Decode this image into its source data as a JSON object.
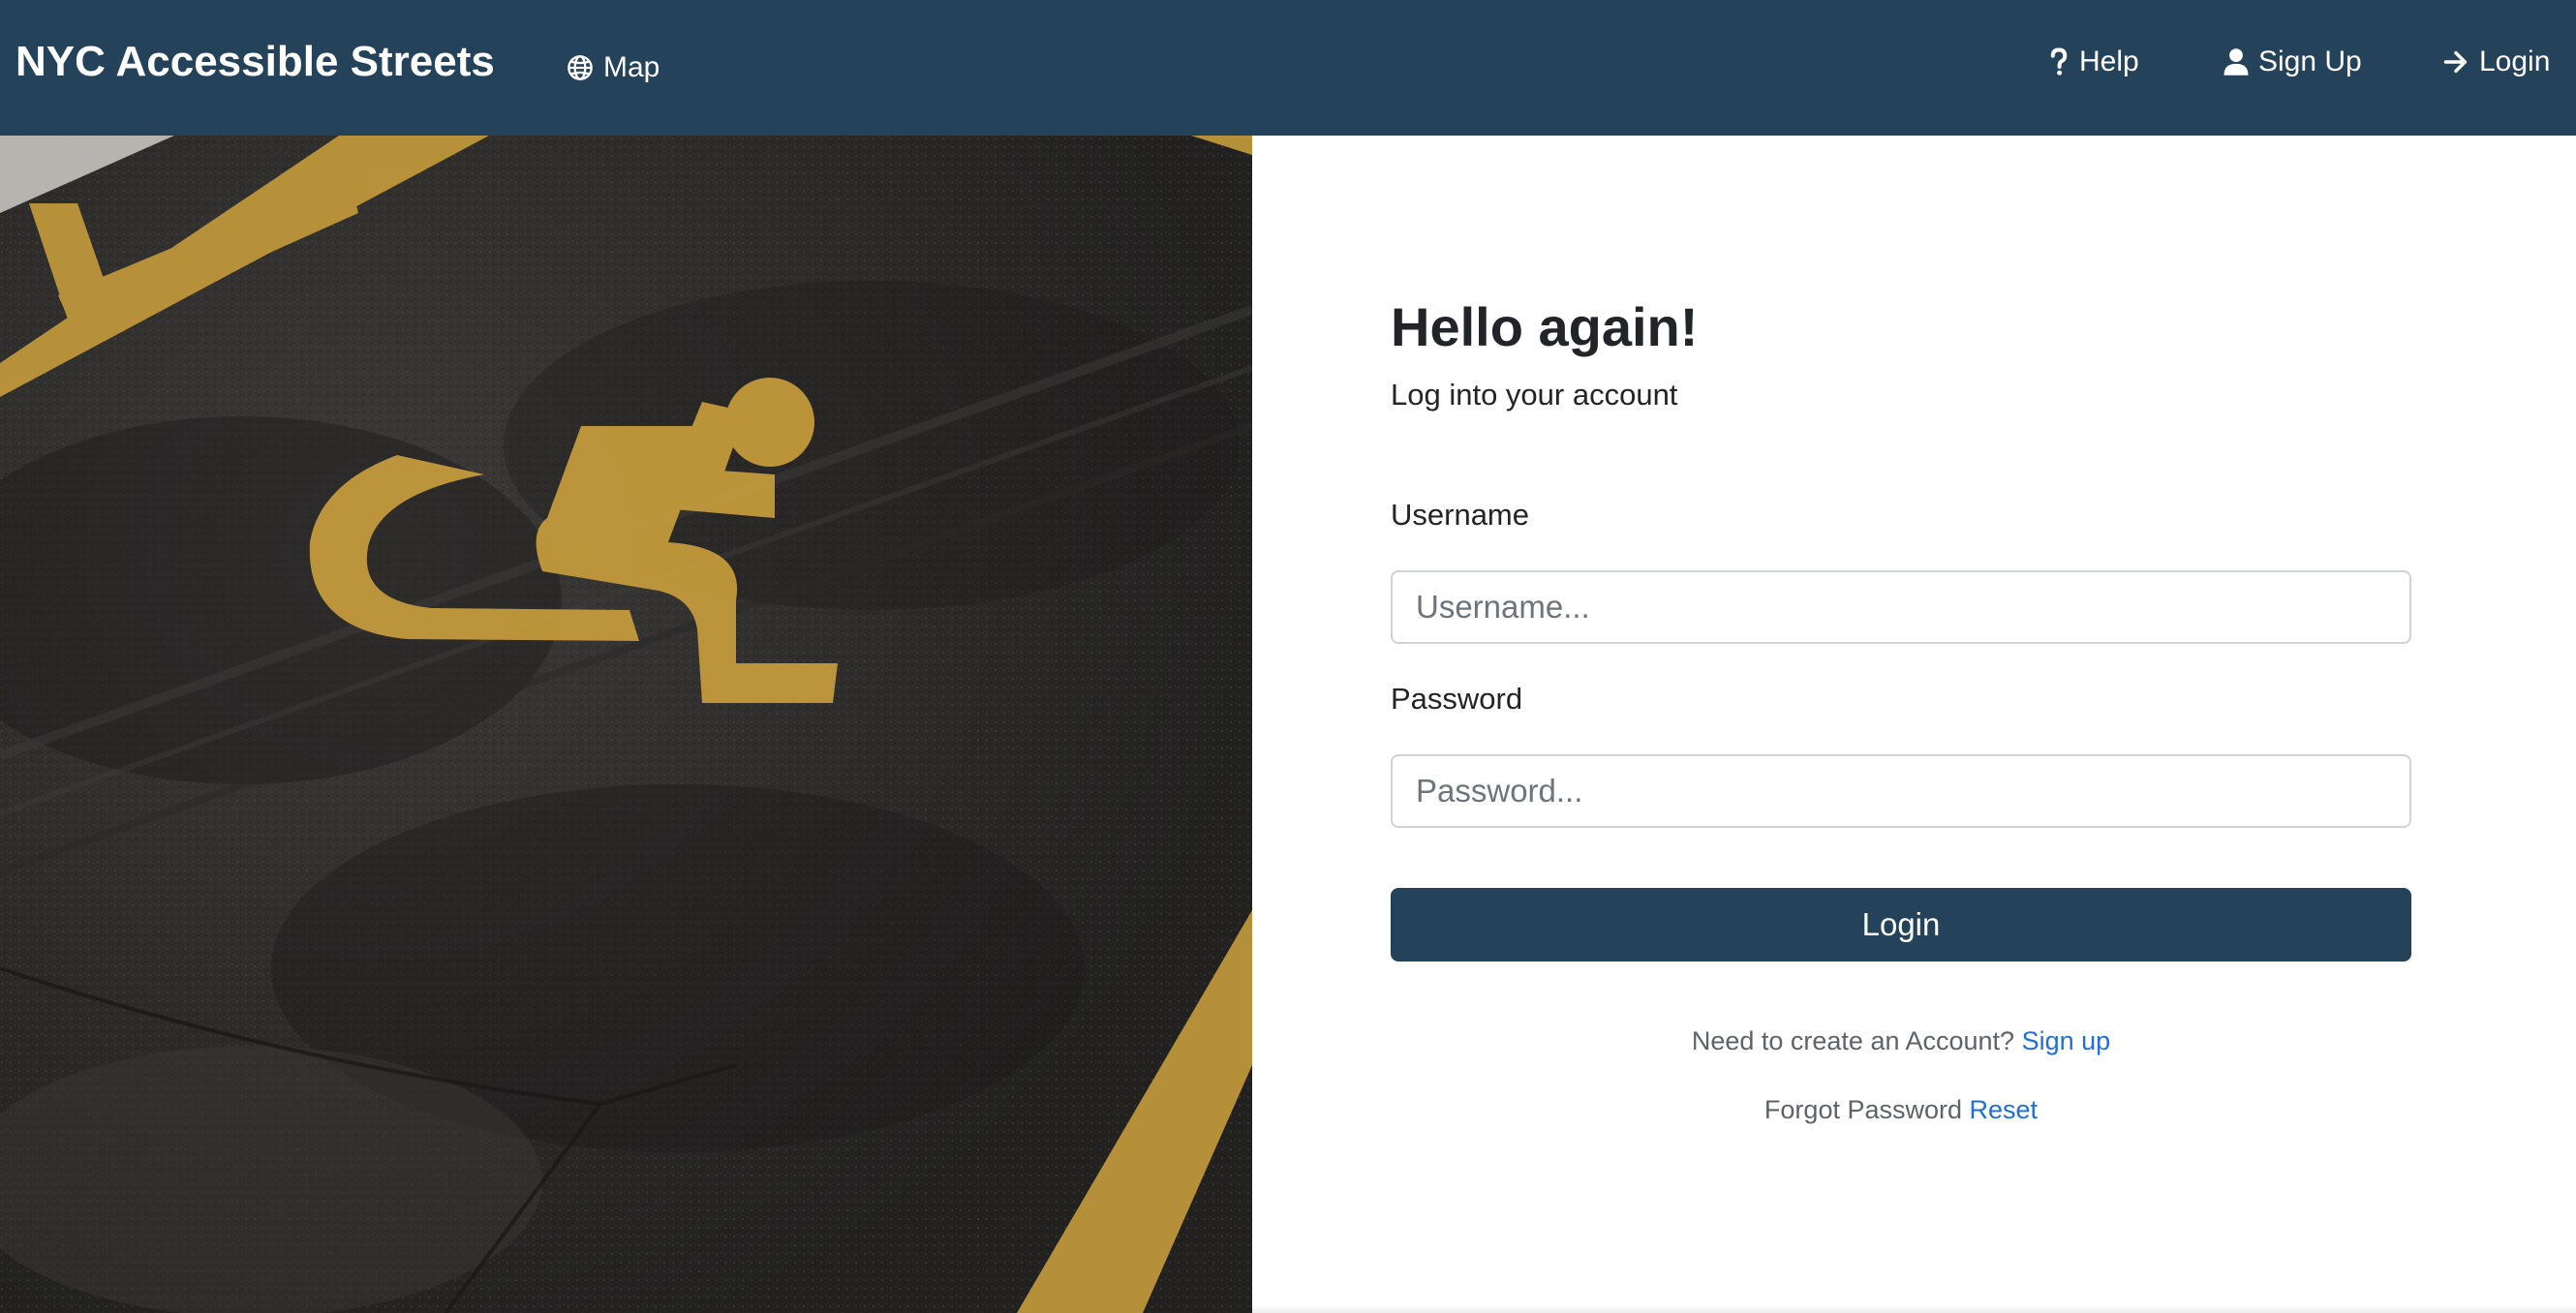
{
  "navbar": {
    "brand": "NYC Accessible Streets",
    "map_label": "Map",
    "help_label": "Help",
    "signup_label": "Sign Up",
    "login_label": "Login",
    "background_color": "#24435a"
  },
  "hero": {
    "description_icon": "wheelchair-symbol-icon",
    "paint_color": "#c39a3c",
    "asphalt_color": "#302f2e"
  },
  "login_form": {
    "title": "Hello again!",
    "subtitle": "Log into your account",
    "username_label": "Username",
    "username_placeholder": "Username...",
    "username_value": "",
    "password_label": "Password",
    "password_placeholder": "Password...",
    "password_value": "",
    "submit_label": "Login",
    "signup_prompt": "Need to create an Account?",
    "signup_link": "Sign up",
    "forgot_prompt": "Forgot Password",
    "reset_link": "Reset",
    "button_color": "#24435a",
    "link_color": "#1f6fd6"
  },
  "icons": {
    "map": "globe-icon",
    "help": "question-icon",
    "signup": "user-icon",
    "login": "arrow-right-icon"
  }
}
